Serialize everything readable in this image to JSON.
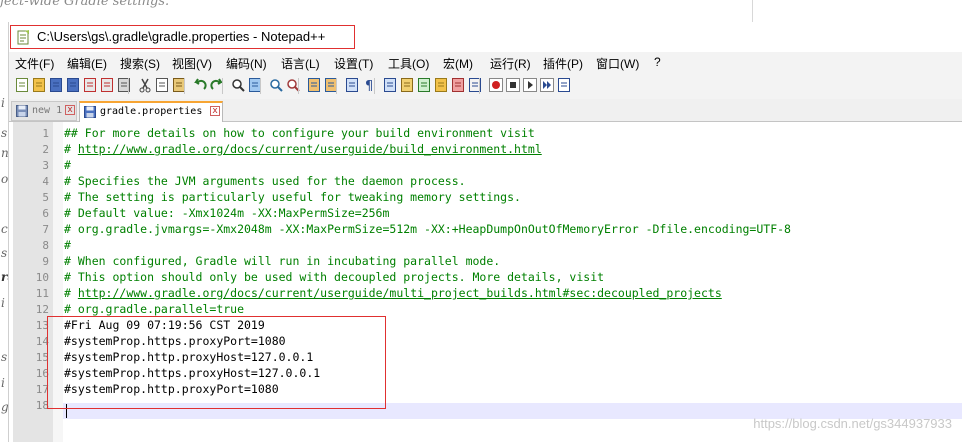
{
  "background": {
    "top_text": "ject-wide Gradle settings.",
    "left_chars": [
      "i",
      "s",
      "n",
      "o",
      "ci",
      "s",
      "ra",
      "i",
      "s",
      "i",
      "g"
    ]
  },
  "window": {
    "title": "C:\\Users\\gs\\.gradle\\gradle.properties - Notepad++"
  },
  "menu": {
    "items": [
      "文件(F)",
      "编辑(E)",
      "搜索(S)",
      "视图(V)",
      "编码(N)",
      "语言(L)",
      "设置(T)",
      "工具(O)",
      "宏(M)",
      "运行(R)",
      "插件(P)",
      "窗口(W)",
      "?"
    ]
  },
  "toolbar": {
    "icons": [
      "new-file-icon",
      "open-file-icon",
      "save-icon",
      "save-all-icon",
      "close-icon",
      "close-all-icon",
      "print-icon",
      "cut-icon",
      "copy-icon",
      "paste-icon",
      "undo-icon",
      "redo-icon",
      "find-icon",
      "replace-icon",
      "zoom-in-icon",
      "zoom-out-icon",
      "sync-vertical-icon",
      "sync-horizontal-icon",
      "word-wrap-icon",
      "show-all-chars-icon",
      "indent-guide-icon",
      "doc-map-icon",
      "function-list-icon",
      "folder-as-workspace-icon",
      "doc-list-icon",
      "monitor-icon",
      "record-macro-icon",
      "stop-macro-icon",
      "play-macro-icon",
      "run-macro-multiple-icon",
      "save-macro-icon"
    ]
  },
  "tabs": [
    {
      "label": "new 1",
      "active": false
    },
    {
      "label": "gradle.properties",
      "active": true
    }
  ],
  "editor": {
    "line_numbers": [
      "1",
      "2",
      "3",
      "4",
      "5",
      "6",
      "7",
      "8",
      "9",
      "10",
      "11",
      "12",
      "13",
      "14",
      "15",
      "16",
      "17",
      "18"
    ],
    "lines": [
      {
        "prefix": "## For more details on how to configure your build environment visit",
        "link": "",
        "style": "comment"
      },
      {
        "prefix": "# ",
        "link": "http://www.gradle.org/docs/current/userguide/build_environment.html",
        "style": "comment"
      },
      {
        "prefix": "#",
        "link": "",
        "style": "comment"
      },
      {
        "prefix": "# Specifies the JVM arguments used for the daemon process.",
        "link": "",
        "style": "comment"
      },
      {
        "prefix": "# The setting is particularly useful for tweaking memory settings.",
        "link": "",
        "style": "comment"
      },
      {
        "prefix": "# Default value: -Xmx1024m -XX:MaxPermSize=256m",
        "link": "",
        "style": "comment"
      },
      {
        "prefix": "# org.gradle.jvmargs=-Xmx2048m -XX:MaxPermSize=512m -XX:+HeapDumpOnOutOfMemoryError -Dfile.encoding=UTF-8",
        "link": "",
        "style": "comment"
      },
      {
        "prefix": "#",
        "link": "",
        "style": "comment"
      },
      {
        "prefix": "# When configured, Gradle will run in incubating parallel mode.",
        "link": "",
        "style": "comment"
      },
      {
        "prefix": "# This option should only be used with decoupled projects. More details, visit",
        "link": "",
        "style": "comment"
      },
      {
        "prefix": "# ",
        "link": "http://www.gradle.org/docs/current/userguide/multi_project_builds.html#sec:decoupled_projects",
        "style": "comment"
      },
      {
        "prefix": "# org.gradle.parallel=true",
        "link": "",
        "style": "comment"
      },
      {
        "prefix": "#Fri Aug 09 07:19:56 CST 2019",
        "link": "",
        "style": "plain"
      },
      {
        "prefix": "#systemProp.https.proxyPort=1080",
        "link": "",
        "style": "plain"
      },
      {
        "prefix": "#systemProp.http.proxyHost=127.0.0.1",
        "link": "",
        "style": "plain"
      },
      {
        "prefix": "#systemProp.https.proxyHost=127.0.0.1",
        "link": "",
        "style": "plain"
      },
      {
        "prefix": "#systemProp.http.proxyPort=1080",
        "link": "",
        "style": "plain"
      },
      {
        "prefix": "",
        "link": "",
        "style": "plain"
      }
    ]
  },
  "watermark": "https://blog.csdn.net/gs344937933",
  "colors": {
    "comment": "#008000",
    "highlight": "#e03030",
    "active_tab_accent": "#f7a533",
    "current_line": "#e8e8ff"
  }
}
